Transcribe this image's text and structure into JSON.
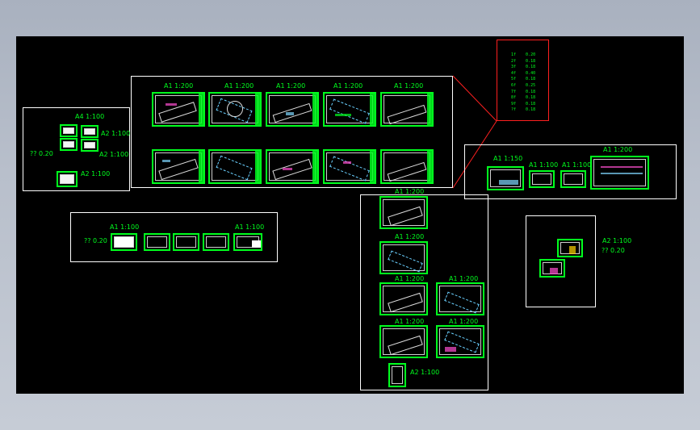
{
  "labels": {
    "g1_top": [
      "A1 1:200",
      "A1 1:200",
      "A1 1:200",
      "A1 1:200",
      "A1 1:200"
    ],
    "left_a4": "A4 1:100",
    "left_a2a": "A2 1:100",
    "left_a2b": "A2 1:100",
    "left_q": "??  0.20",
    "left_a2c": "A2 1:100",
    "row_a1a": "A1 1:100",
    "row_a1b": "A1 1:100",
    "row_q": "??  0.20",
    "right_a1_150": "A1 1:150",
    "right_a1_100a": "A1 1:100",
    "right_a1_100b": "A1 1:100",
    "right_a1_200": "A1 1:200",
    "col_a": "A1 1:200",
    "col_b": "A1 1:200",
    "col_c1": "A1 1:200",
    "col_c2": "A1 1:200",
    "col_d1": "A1 1:200",
    "col_d2": "A1 1:200",
    "col_a2": "A2 1:100",
    "far_a2": "A2 1:100",
    "far_q": "??  0.20"
  },
  "legend_rows": [
    {
      "k": "1f",
      "v": "0.20"
    },
    {
      "k": "2f",
      "v": "0.18"
    },
    {
      "k": "3f",
      "v": "0.18"
    },
    {
      "k": "4f",
      "v": "0.40"
    },
    {
      "k": "5f",
      "v": "0.18"
    },
    {
      "k": "6f",
      "v": "0.25"
    },
    {
      "k": "7f",
      "v": "0.18"
    },
    {
      "k": "8f",
      "v": "0.18"
    },
    {
      "k": "9f",
      "v": "0.18"
    },
    {
      "k": "?f",
      "v": "0.18"
    }
  ],
  "colors": {
    "viewport": "#000000",
    "sheet_border": "#00ff1e",
    "frame": "#ffffff",
    "callout": "#ff2020"
  }
}
